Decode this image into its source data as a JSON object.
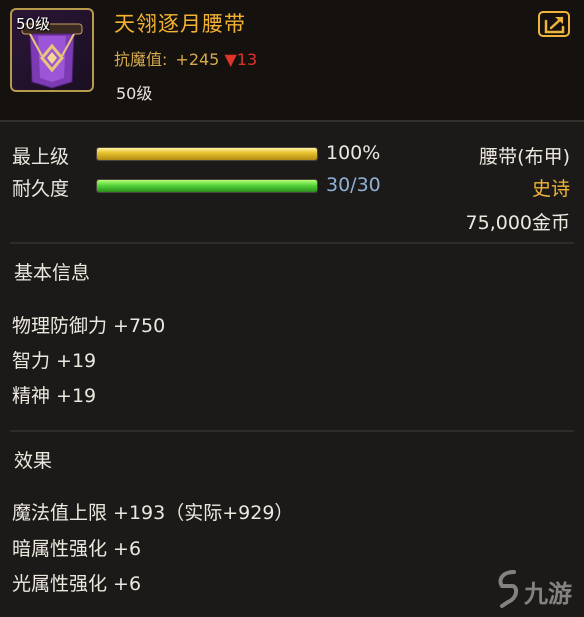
{
  "item": {
    "icon_level": "50级",
    "name": "天翎逐月腰带",
    "magic_res_label": "抗魔值:",
    "magic_res_value": "+245",
    "magic_res_diff": "▼13",
    "required_level": "50级",
    "icon": "belt-item-icon",
    "share_icon": "share-icon"
  },
  "bars": {
    "enhance": {
      "label": "最上级",
      "value_text": "100%",
      "fill": 1.0
    },
    "durability": {
      "label": "耐久度",
      "value_text": "30/30",
      "fill": 1.0
    }
  },
  "meta": {
    "type": "腰带(布甲)",
    "rarity": "史诗",
    "price": "75,000金币"
  },
  "basic_info": {
    "title": "基本信息",
    "stats": [
      "物理防御力 +750",
      "智力 +19",
      "精神 +19"
    ]
  },
  "effects": {
    "title": "效果",
    "stats": [
      "魔法值上限 +193（实际+929）",
      "暗属性强化 +6",
      "光属性强化 +6"
    ]
  },
  "watermark": {
    "text": "九游"
  },
  "colors": {
    "name": "#f3b232",
    "rarity": "#f0b43a",
    "durability_text": "#8fb1d6",
    "diff_down": "#e0342b"
  }
}
